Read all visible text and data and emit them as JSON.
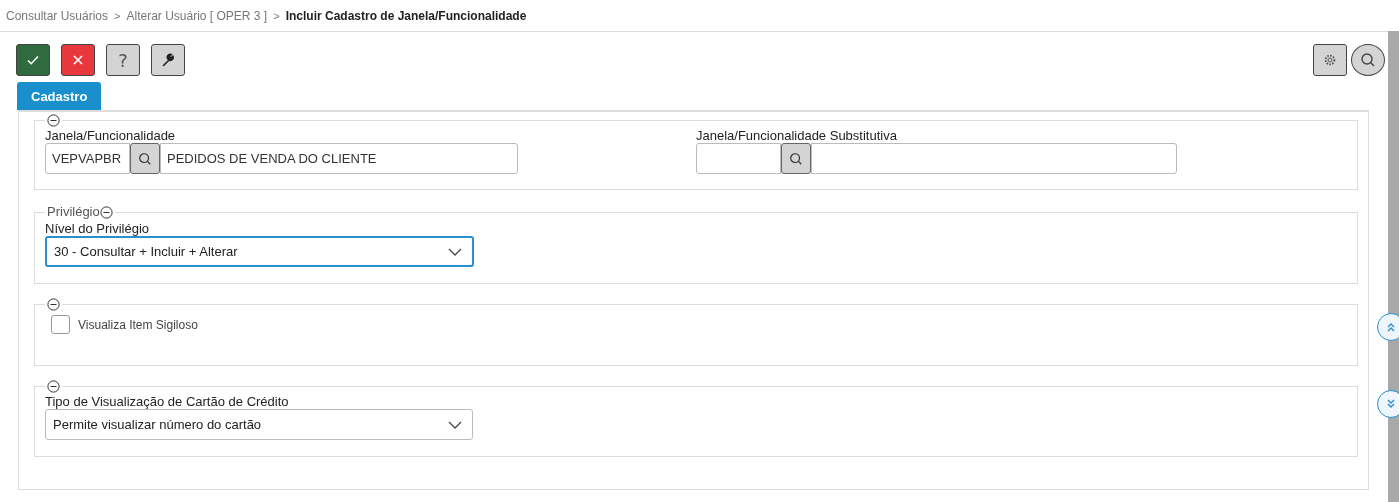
{
  "breadcrumb": [
    {
      "label": "Consultar Usuários",
      "current": false
    },
    {
      "label": "Alterar Usuário [ OPER 3 ]",
      "current": false
    },
    {
      "label": "Incluir Cadastro de Janela/Funcionalidade",
      "current": true
    }
  ],
  "breadcrumb_separator": ">",
  "toolbar": [
    {
      "kind": "confirm"
    },
    {
      "kind": "cancel"
    },
    {
      "kind": "help",
      "label": "?"
    },
    {
      "kind": "tool"
    }
  ],
  "toolbar_right": [
    {
      "kind": "settings"
    },
    {
      "kind": "search"
    }
  ],
  "tabs": [
    {
      "label": "Cadastro",
      "selected": true
    }
  ],
  "sections": [
    {
      "kind": "lookups",
      "lookups": [
        {
          "label": "Janela/Funcionalidade",
          "code": "VEPVAPBR",
          "description": "PEDIDOS DE VENDA DO CLIENTE"
        },
        {
          "label": "Janela/Funcionalidade Substitutiva"
        }
      ]
    },
    {
      "kind": "select",
      "legend": "Privilégio",
      "label": "Nível do Privilégio",
      "value": "30 - Consultar + Incluir + Alterar",
      "focused": true
    },
    {
      "kind": "checkbox",
      "label": "Visualiza Item Sigiloso",
      "checked": false
    },
    {
      "kind": "select",
      "label": "Tipo de Visualização de Cartão de Crédito",
      "value": "Permite visualizar número do cartão",
      "focused": false
    }
  ]
}
